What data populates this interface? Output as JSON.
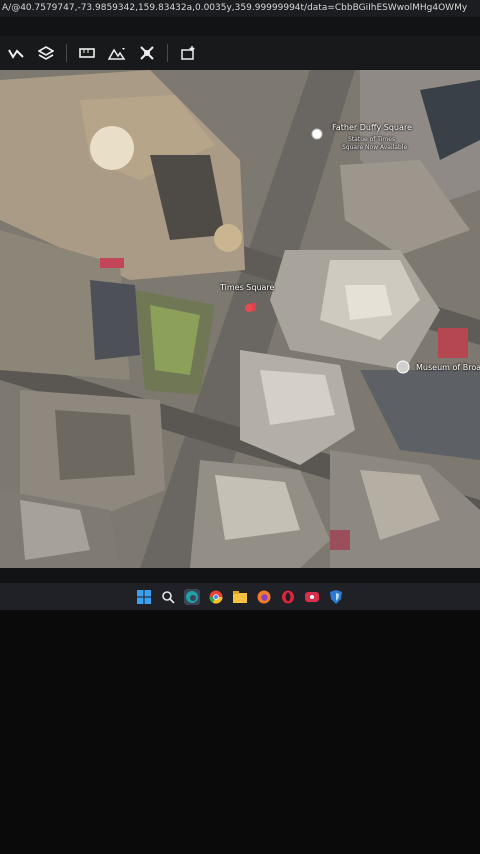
{
  "browser": {
    "url": "A/@40.7579747,-73.9859342,159.83432a,0.0035y,359.99999994t/data=CbbBGiIhESWwolMHg4OWMy"
  },
  "toolbar": {
    "icons": [
      "measure-path-icon",
      "layers-icon",
      "ruler-icon",
      "map-style-icon",
      "projects-icon",
      "add-placemark-icon"
    ]
  },
  "map": {
    "labels": {
      "father_duffy": "Father Duffy Square",
      "father_duffy_sub1": "Statue of Times",
      "father_duffy_sub2": "Square Now Available",
      "times_square": "Times Square",
      "museum": "Museum of Broa"
    }
  },
  "taskbar": {
    "apps": [
      "start-icon",
      "search-icon",
      "edge-icon",
      "chrome-icon",
      "file-explorer-icon",
      "firefox-icon",
      "opera-icon",
      "media-app-icon",
      "shield-app-icon"
    ]
  }
}
